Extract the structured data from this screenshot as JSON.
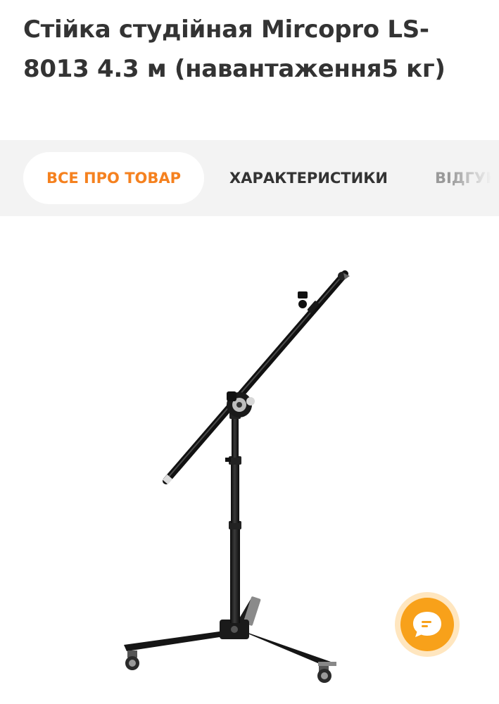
{
  "product": {
    "title": "Стійка студійная Mircopro LS-8013 4.3 м (навантаження5 кг)"
  },
  "tabs": [
    {
      "label": "ВСЕ ПРО ТОВАР",
      "active": true
    },
    {
      "label": "ХАРАКТЕРИСТИКИ",
      "active": false
    },
    {
      "label": "ВІДГУКИ",
      "active": false
    }
  ],
  "image": {
    "subject": "boom light stand on wheeled tripod base"
  },
  "chat": {
    "icon": "chat-bubble-icon"
  },
  "colors": {
    "accent": "#f5811f",
    "chat_button": "#f8a11a",
    "chat_halo": "#ffe6bf",
    "tabs_background": "#f3f3f3",
    "title_text": "#333333"
  }
}
